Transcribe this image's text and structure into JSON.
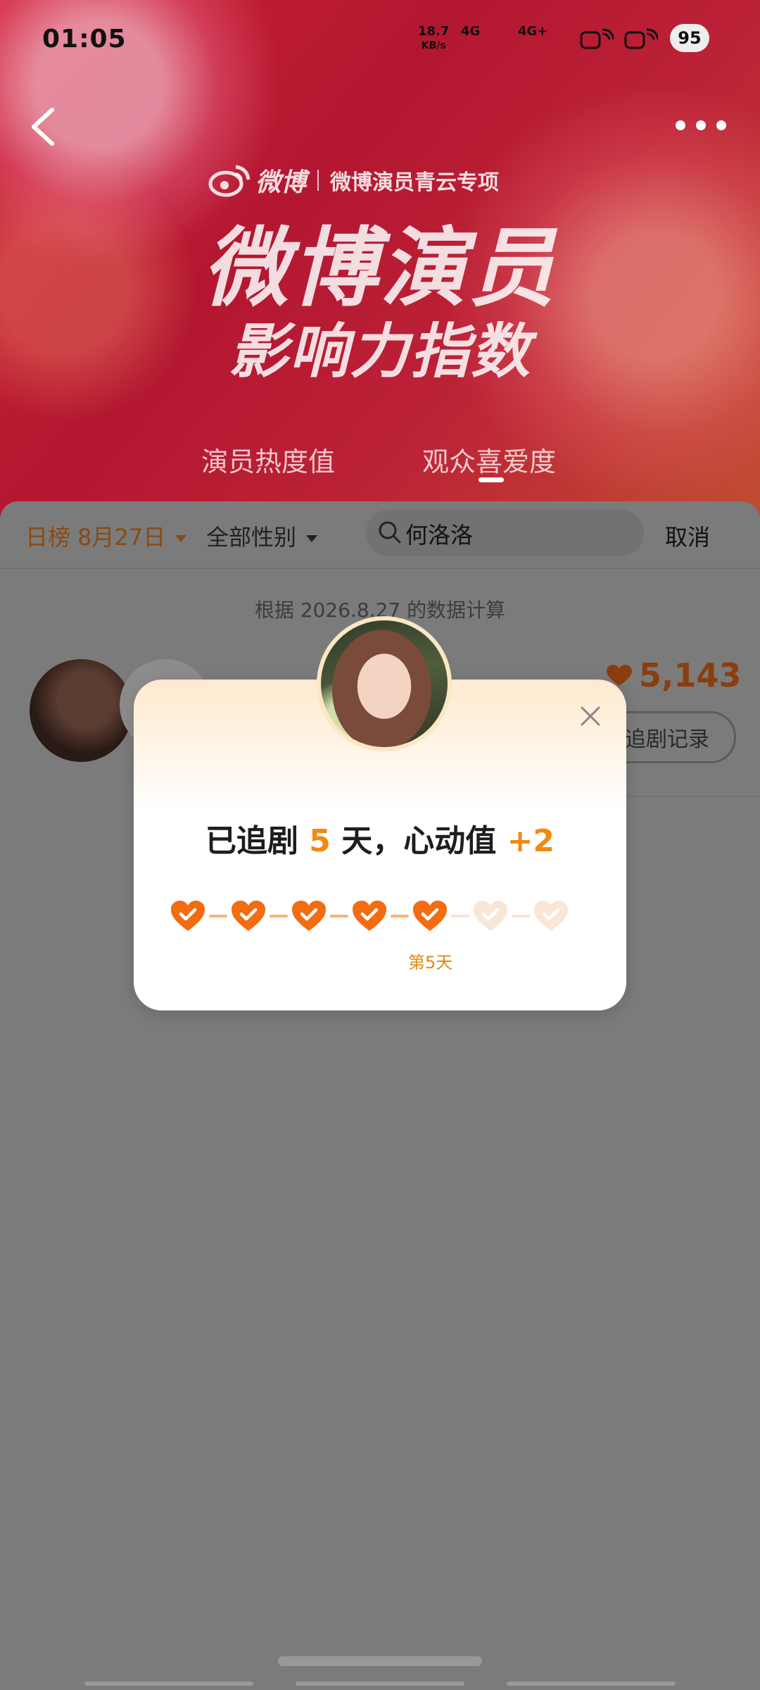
{
  "status": {
    "time": "01:05",
    "net_speed": "18.7",
    "net_unit": "KB/s",
    "sim1": "4G",
    "sim2": "4G+",
    "battery": "95"
  },
  "header": {
    "brand_logo_text": "微博",
    "brand_sub": "微博演员青云专项",
    "title": "微博演员",
    "subtitle": "影响力指数",
    "tabs": [
      {
        "label": "演员热度值"
      },
      {
        "label": "观众喜爱度"
      }
    ]
  },
  "filters": {
    "date": "日榜 8月27日",
    "gender": "全部性别",
    "search_value": "何洛洛",
    "cancel": "取消"
  },
  "calc_note": "根据 2026.8.27 的数据计算",
  "row": {
    "score": "5,143",
    "record_button": "追剧记录"
  },
  "modal": {
    "title_prefix": "已追剧",
    "days": "5",
    "title_mid": "天，心动值",
    "plus": "+2",
    "streak_total": 7,
    "streak_done": 5,
    "day_label": "第5天"
  },
  "colors": {
    "accent": "#f08a12",
    "heart_on": "#f26c10",
    "heart_off": "#f9e6d6"
  }
}
